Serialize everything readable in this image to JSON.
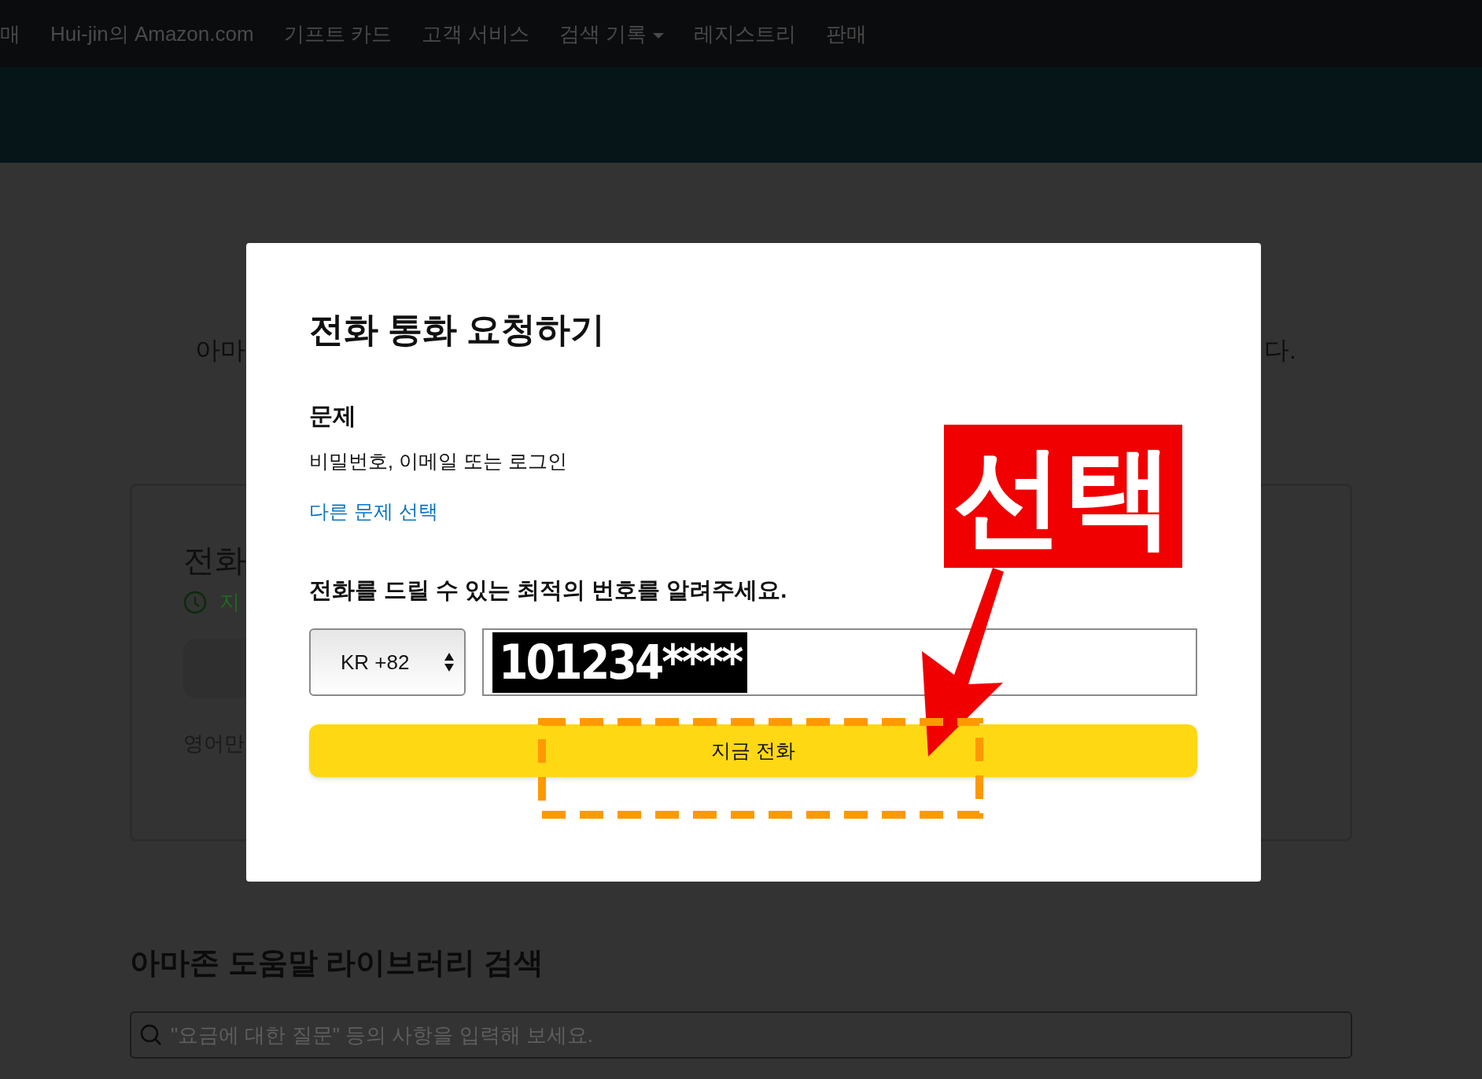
{
  "nav": {
    "items": [
      {
        "label": "매",
        "dropdown": false
      },
      {
        "label": "Hui-jin의 Amazon.com",
        "dropdown": false
      },
      {
        "label": "기프트 카드",
        "dropdown": false
      },
      {
        "label": "고객 서비스",
        "dropdown": false
      },
      {
        "label": "검색 기록",
        "dropdown": true
      },
      {
        "label": "레지스트리",
        "dropdown": false
      },
      {
        "label": "판매",
        "dropdown": false
      }
    ]
  },
  "background": {
    "text_left": "아마",
    "text_right": "다.",
    "card": {
      "title": "전화",
      "status": "지",
      "note": "영어만"
    },
    "help_heading": "아마존 도움말 라이브러리 검색",
    "search": {
      "placeholder": "\"요금에 대한 질문\" 등의 사항을 입력해 보세요."
    }
  },
  "modal": {
    "title": "전화 통화 요청하기",
    "problem_label": "문제",
    "problem": "비밀번호, 이메일 또는 로그인",
    "change_link": "다른 문제 선택",
    "prompt": "전화를 드릴 수 있는 최적의 번호를 알려주세요.",
    "country_select": {
      "value": "KR +82"
    },
    "phone_input": {
      "redacted_value": "101234****"
    },
    "call_button": "지금 전화"
  },
  "annotations": [
    {
      "kind": "label",
      "text": "선택"
    },
    {
      "kind": "arrow"
    },
    {
      "kind": "dashed_box"
    }
  ]
}
